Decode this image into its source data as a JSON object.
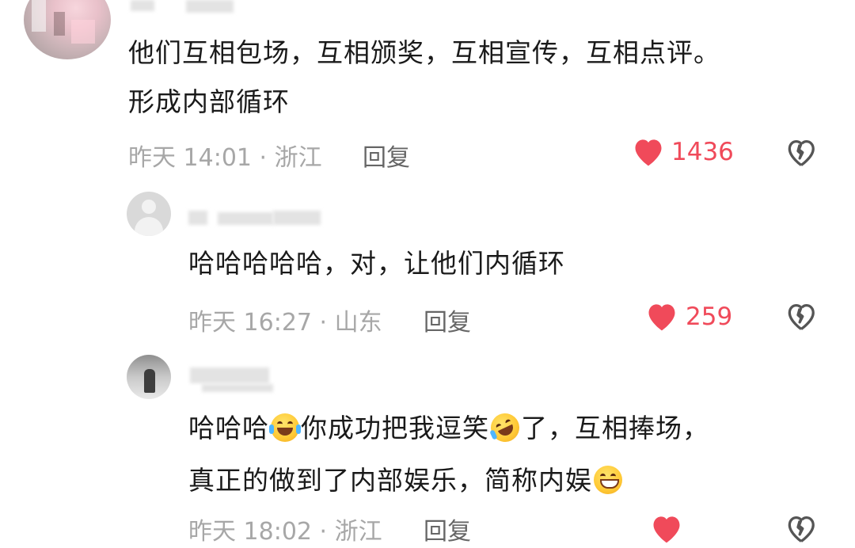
{
  "comments": [
    {
      "text_lines": [
        "他们互相包场，互相颁奖，互相宣传，互相点评。",
        "形成内部循环"
      ],
      "meta": "昨天 14:01 · 浙江",
      "reply_label": "回复",
      "likes": "1436",
      "avatar_icon": "blurred-avatar-icon",
      "like_icon": "heart-icon",
      "dislike_icon": "broken-heart-icon"
    },
    {
      "text_lines": [
        "哈哈哈哈哈，对，让他们内循环"
      ],
      "meta": "昨天 16:27 · 山东",
      "reply_label": "回复",
      "likes": "259",
      "avatar_icon": "default-user-avatar-icon",
      "like_icon": "heart-icon",
      "dislike_icon": "broken-heart-icon"
    },
    {
      "line1_parts": [
        "哈哈哈",
        "你成功把我逗笑",
        "了，互相捧场，"
      ],
      "line2_text": "真正的做到了内部娱乐，简称内娱",
      "meta": "昨天 18:02 · 浙江",
      "reply_label": "回复",
      "avatar_icon": "photo-avatar-icon"
    }
  ],
  "colors": {
    "text": "#1a1a1a",
    "meta": "#a7a7a7",
    "like": "#f04a5a"
  }
}
